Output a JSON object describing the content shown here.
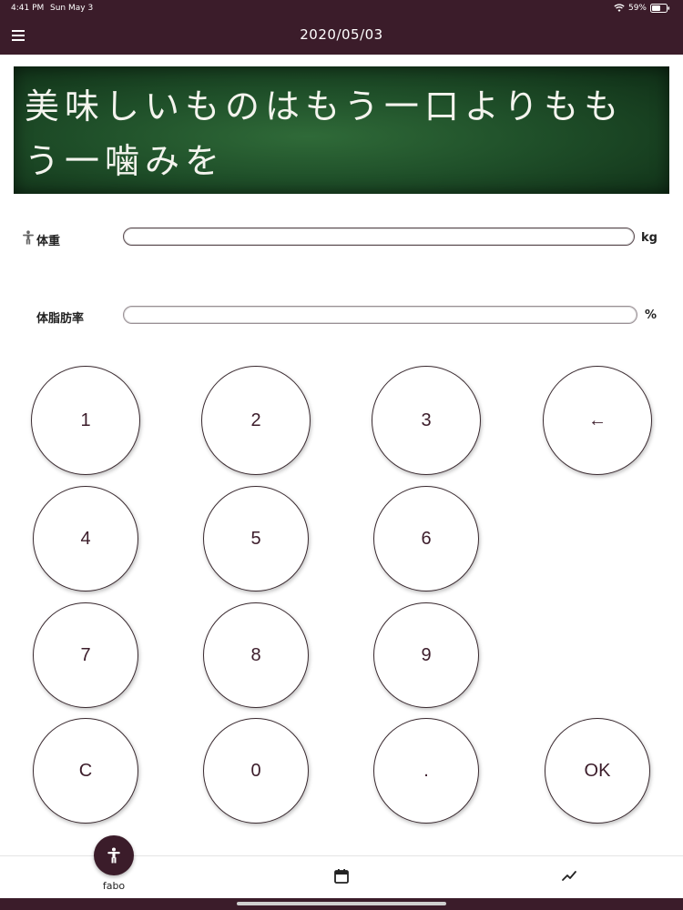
{
  "status_bar": {
    "time": "4:41 PM",
    "date": "Sun May 3",
    "battery": "59%"
  },
  "header": {
    "title": "2020/05/03",
    "background": "#3b1c2a"
  },
  "banner": {
    "text": "美味しいものはもう一口よりももう一噛みを",
    "background": "#1f4f29"
  },
  "form": {
    "weight": {
      "label": "体重",
      "value": "",
      "unit": "kg",
      "icon": "person-icon"
    },
    "body_fat": {
      "label": "体脂肪率",
      "value": "",
      "unit": "%"
    }
  },
  "keypad": {
    "keys": [
      "1",
      "2",
      "3",
      "←",
      "4",
      "5",
      "6",
      "7",
      "8",
      "9",
      "C",
      "0",
      ".",
      "OK"
    ]
  },
  "bottom_nav": {
    "items": [
      {
        "label": "fabo",
        "icon": "person-icon",
        "active": true
      },
      {
        "label": "",
        "icon": "calendar-icon",
        "active": false
      },
      {
        "label": "",
        "icon": "trend-chart-icon",
        "active": false
      }
    ]
  },
  "colors": {
    "accent": "#3b1c2a",
    "key_border": "#3a2a30"
  }
}
